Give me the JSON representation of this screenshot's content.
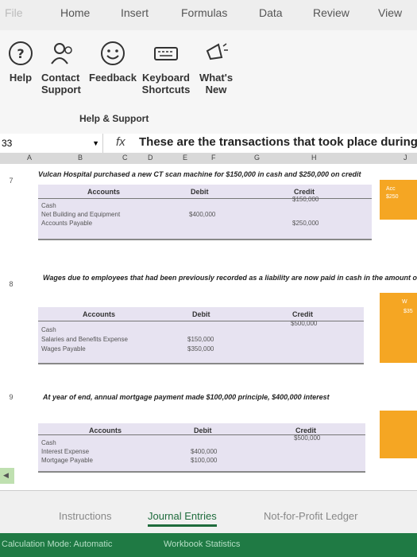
{
  "tabs": [
    "File",
    "Home",
    "Insert",
    "Formulas",
    "Data",
    "Review",
    "View"
  ],
  "ribbon": {
    "buttons": [
      {
        "label": "Help",
        "icon": "question-circle-icon"
      },
      {
        "label": "Contact Support",
        "icon": "people-icon"
      },
      {
        "label": "Feedback",
        "icon": "smiley-icon"
      },
      {
        "label": "Keyboard Shortcuts",
        "icon": "keyboard-icon"
      },
      {
        "label": "What's New",
        "icon": "megaphone-icon"
      }
    ],
    "group_label": "Help & Support"
  },
  "formula_bar": {
    "cell": "33",
    "fx": "fx",
    "content": "These are the transactions that took place during"
  },
  "columns": [
    "A",
    "B",
    "C",
    "D",
    "E",
    "F",
    "G",
    "H",
    "J"
  ],
  "rows": [
    {
      "num": "7",
      "text": "Vulcan Hospital purchased a new CT scan machine for $150,000 in cash and $250,000 on credit",
      "headers": {
        "account": "Accounts",
        "debit": "Debit",
        "credit": "Credit"
      },
      "entries": [
        {
          "account": "Cash",
          "debit": "",
          "credit": "$150,000"
        },
        {
          "account": "Net Building and Equipment",
          "debit": "$400,000",
          "credit": ""
        },
        {
          "account": "Accounts Payable",
          "debit": "",
          "credit": "$250,000"
        }
      ],
      "side": [
        "Acc",
        "$250"
      ]
    },
    {
      "num": "8",
      "text": "Wages due to employees that had been previously recorded as a liability are now paid in cash in the amount of $",
      "headers": {
        "account": "Accounts",
        "debit": "Debit",
        "credit": "Credit"
      },
      "entries": [
        {
          "account": "Cash",
          "debit": "",
          "credit": "$500,000"
        },
        {
          "account": "Salaries and Benefits Expense",
          "debit": "$150,000",
          "credit": ""
        },
        {
          "account": "Wages Payable",
          "debit": "$350,000",
          "credit": ""
        }
      ],
      "side": [
        "W",
        "$35"
      ]
    },
    {
      "num": "9",
      "text": "At year of end, annual mortgage payment made $100,000 principle, $400,000 interest",
      "headers": {
        "account": "Accounts",
        "debit": "Debit",
        "credit": "Credit"
      },
      "entries": [
        {
          "account": "Cash",
          "debit": "",
          "credit": "$500,000"
        },
        {
          "account": "Interest Expense",
          "debit": "$400,000",
          "credit": ""
        },
        {
          "account": "Mortgage Payable",
          "debit": "$100,000",
          "credit": ""
        }
      ],
      "side": []
    }
  ],
  "sheet_tabs": [
    "Instructions",
    "Journal Entries",
    "Not-for-Profit Ledger"
  ],
  "active_tab": "Journal Entries",
  "status": [
    "Calculation Mode: Automatic",
    "Workbook Statistics"
  ],
  "colors": {
    "accent": "#1f7a44",
    "table_bg": "#e7e3f1",
    "highlight": "#f5a623"
  }
}
